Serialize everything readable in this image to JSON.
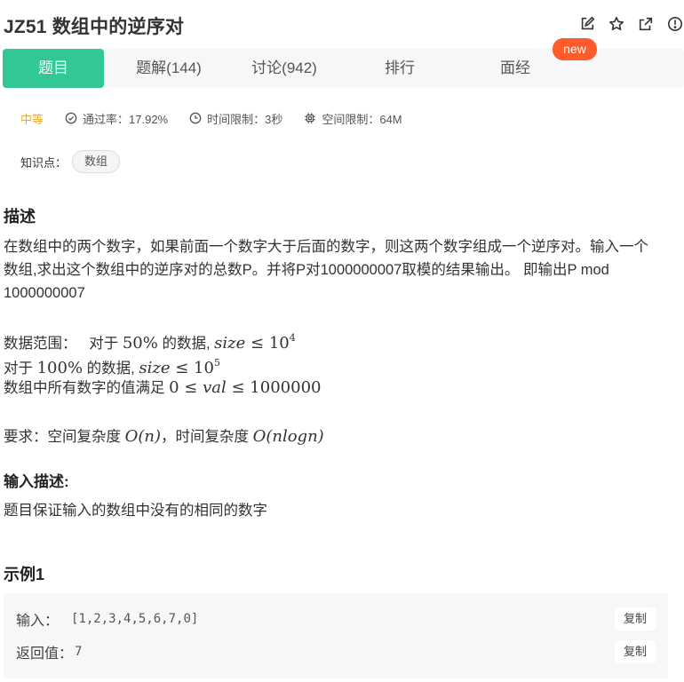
{
  "problem": {
    "title": "JZ51  数组中的逆序对"
  },
  "header_icons": [
    "edit-icon",
    "star-icon",
    "share-icon",
    "report-icon"
  ],
  "tabs": [
    {
      "label": "题目",
      "active": true
    },
    {
      "label": "题解(144)",
      "active": false
    },
    {
      "label": "讨论(942)",
      "active": false
    },
    {
      "label": "排行",
      "active": false
    },
    {
      "label": "面经",
      "active": false
    }
  ],
  "badge": {
    "label": "new"
  },
  "meta": {
    "difficulty": "中等",
    "pass_rate": "通过率：17.92%",
    "time_limit": "时间限制：3秒",
    "space_limit": "空间限制：64M"
  },
  "knowledge": {
    "label": "知识点：",
    "tag": "数组"
  },
  "description": {
    "heading": "描述",
    "text": "在数组中的两个数字，如果前面一个数字大于后面的数字，则这两个数字组成一个逆序对。输入一个数组,求出这个数组中的逆序对的总数P。并将P对1000000007取模的结果输出。 即输出P mod 1000000007",
    "range_label": "数据范围：",
    "range_line1_a": "对于",
    "range_line1_pct": "50%",
    "range_line1_b": "的数据,",
    "range_line1_var": "size",
    "range_line1_le": "≤",
    "range_line1_base": "10",
    "range_line1_exp": "4",
    "range_line2_a": "对于",
    "range_line2_pct": "100%",
    "range_line2_b": "的数据,",
    "range_line2_var": "size",
    "range_line2_le": "≤",
    "range_line2_base": "10",
    "range_line2_exp": "5",
    "range_line3_a": "数组中所有数字的值满足",
    "range_line3_math_a": "0 ≤",
    "range_line3_var": "val",
    "range_line3_math_b": "≤ 1000000",
    "req_a": "要求：空间复杂度",
    "req_space": "O(n)",
    "req_b": "，时间复杂度",
    "req_time": "O(nlogn)"
  },
  "input_desc": {
    "heading": "输入描述:",
    "text": "题目保证输入的数组中没有的相同的数字"
  },
  "example": {
    "heading": "示例1",
    "input_label": "输入：",
    "input_value": "[1,2,3,4,5,6,7,0]",
    "output_label": "返回值：",
    "output_value": "7",
    "copy_label": "复制"
  }
}
